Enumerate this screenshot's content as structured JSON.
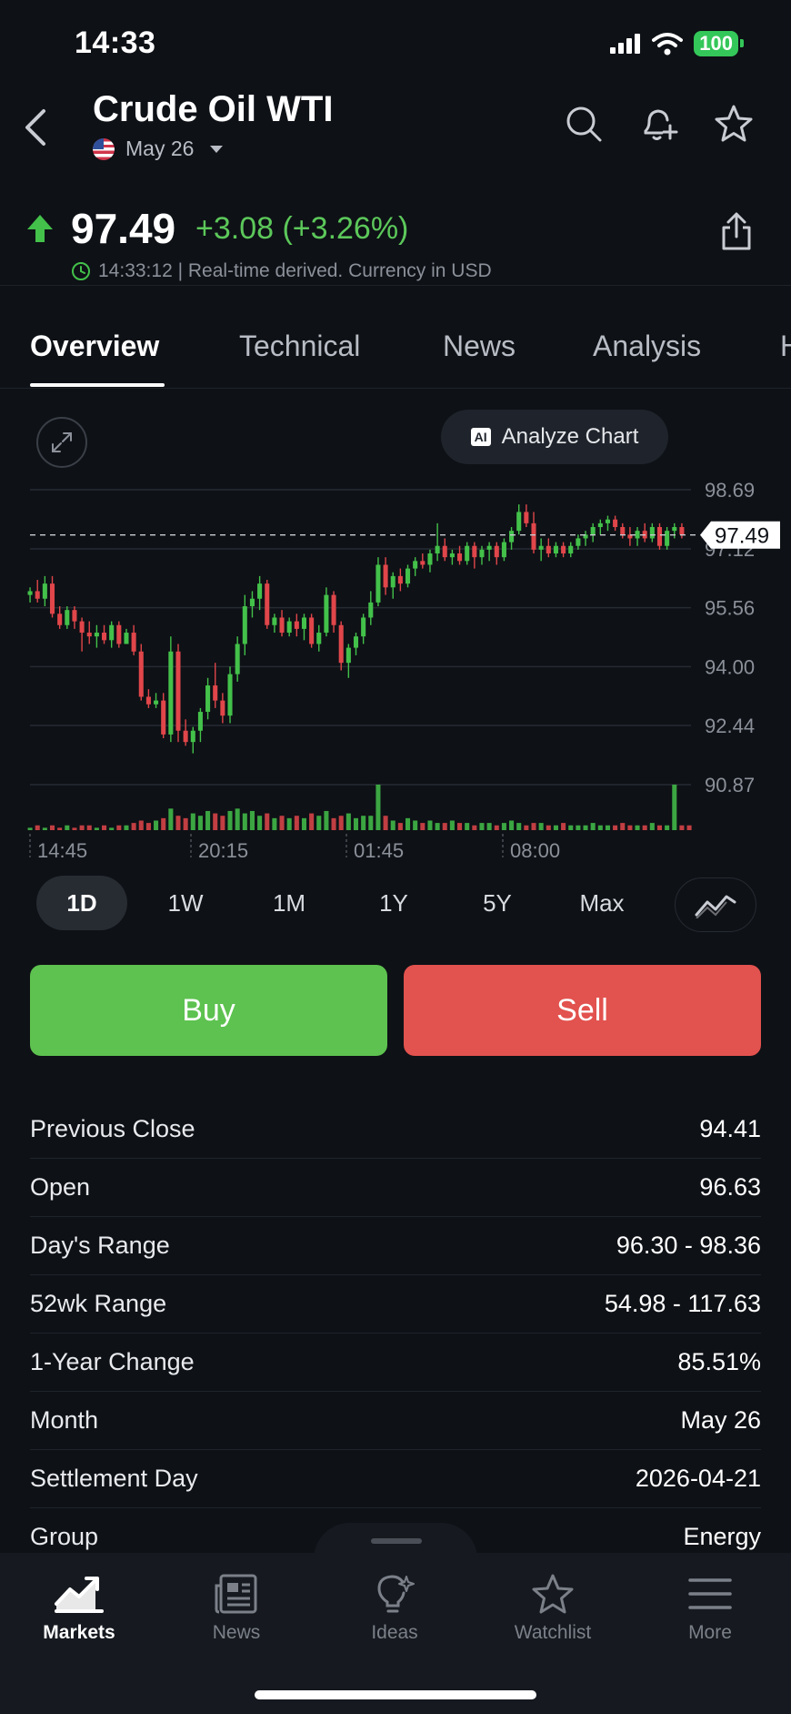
{
  "status_bar": {
    "time": "14:33",
    "battery": "100"
  },
  "header": {
    "title": "Crude Oil WTI",
    "contract": "May 26"
  },
  "quote": {
    "price": "97.49",
    "change": "+3.08 (+3.26%)",
    "timestamp_note": "14:33:12 | Real-time derived. Currency in USD",
    "up_color": "#5cc85a"
  },
  "tabs": [
    "Overview",
    "Technical",
    "News",
    "Analysis",
    "H"
  ],
  "analyze_label": "Analyze Chart",
  "ai_badge": "AI",
  "chart_data": {
    "type": "candlestick",
    "y_ticks": [
      "98.69",
      "97.12",
      "95.56",
      "94.00",
      "92.44",
      "90.87"
    ],
    "ylim": [
      90.87,
      98.69
    ],
    "x_ticks": [
      "14:45",
      "20:15",
      "01:45",
      "08:00"
    ],
    "last_price_label": "97.49",
    "up_color": "#43c14a",
    "down_color": "#e0464a",
    "series": [
      {
        "o": 95.9,
        "h": 96.1,
        "l": 95.7,
        "c": 96.0
      },
      {
        "o": 96.0,
        "h": 96.3,
        "l": 95.7,
        "c": 95.8
      },
      {
        "o": 95.8,
        "h": 96.4,
        "l": 95.6,
        "c": 96.2
      },
      {
        "o": 96.2,
        "h": 96.4,
        "l": 95.3,
        "c": 95.4
      },
      {
        "o": 95.4,
        "h": 95.6,
        "l": 95.0,
        "c": 95.1
      },
      {
        "o": 95.1,
        "h": 95.6,
        "l": 95.0,
        "c": 95.5
      },
      {
        "o": 95.5,
        "h": 95.6,
        "l": 95.0,
        "c": 95.2
      },
      {
        "o": 95.2,
        "h": 95.3,
        "l": 94.4,
        "c": 94.9
      },
      {
        "o": 94.9,
        "h": 95.2,
        "l": 94.6,
        "c": 94.8
      },
      {
        "o": 94.8,
        "h": 95.1,
        "l": 94.5,
        "c": 94.9
      },
      {
        "o": 94.9,
        "h": 95.1,
        "l": 94.6,
        "c": 94.7
      },
      {
        "o": 94.7,
        "h": 95.2,
        "l": 94.5,
        "c": 95.1
      },
      {
        "o": 95.1,
        "h": 95.2,
        "l": 94.5,
        "c": 94.6
      },
      {
        "o": 94.6,
        "h": 95.0,
        "l": 94.6,
        "c": 94.9
      },
      {
        "o": 94.9,
        "h": 95.1,
        "l": 94.3,
        "c": 94.4
      },
      {
        "o": 94.4,
        "h": 94.6,
        "l": 93.1,
        "c": 93.2
      },
      {
        "o": 93.2,
        "h": 93.4,
        "l": 92.9,
        "c": 93.0
      },
      {
        "o": 93.0,
        "h": 93.3,
        "l": 92.9,
        "c": 93.1
      },
      {
        "o": 93.1,
        "h": 93.3,
        "l": 92.1,
        "c": 92.2
      },
      {
        "o": 92.2,
        "h": 94.8,
        "l": 92.0,
        "c": 94.4
      },
      {
        "o": 94.4,
        "h": 94.6,
        "l": 92.0,
        "c": 92.3
      },
      {
        "o": 92.3,
        "h": 92.6,
        "l": 91.9,
        "c": 92.0
      },
      {
        "o": 92.0,
        "h": 92.4,
        "l": 91.7,
        "c": 92.3
      },
      {
        "o": 92.3,
        "h": 92.9,
        "l": 92.0,
        "c": 92.8
      },
      {
        "o": 92.8,
        "h": 93.7,
        "l": 92.6,
        "c": 93.5
      },
      {
        "o": 93.5,
        "h": 94.1,
        "l": 92.9,
        "c": 93.1
      },
      {
        "o": 93.1,
        "h": 93.3,
        "l": 92.5,
        "c": 92.7
      },
      {
        "o": 92.7,
        "h": 94.0,
        "l": 92.5,
        "c": 93.8
      },
      {
        "o": 93.8,
        "h": 94.8,
        "l": 93.6,
        "c": 94.6
      },
      {
        "o": 94.6,
        "h": 95.9,
        "l": 94.3,
        "c": 95.6
      },
      {
        "o": 95.6,
        "h": 96.0,
        "l": 95.3,
        "c": 95.8
      },
      {
        "o": 95.8,
        "h": 96.4,
        "l": 95.5,
        "c": 96.2
      },
      {
        "o": 96.2,
        "h": 96.3,
        "l": 95.0,
        "c": 95.1
      },
      {
        "o": 95.1,
        "h": 95.4,
        "l": 94.9,
        "c": 95.3
      },
      {
        "o": 95.3,
        "h": 95.5,
        "l": 94.8,
        "c": 94.9
      },
      {
        "o": 94.9,
        "h": 95.3,
        "l": 94.8,
        "c": 95.2
      },
      {
        "o": 95.2,
        "h": 95.4,
        "l": 94.8,
        "c": 95.0
      },
      {
        "o": 95.0,
        "h": 95.4,
        "l": 94.7,
        "c": 95.3
      },
      {
        "o": 95.3,
        "h": 95.4,
        "l": 94.5,
        "c": 94.6
      },
      {
        "o": 94.6,
        "h": 95.1,
        "l": 94.4,
        "c": 94.9
      },
      {
        "o": 94.9,
        "h": 96.1,
        "l": 94.8,
        "c": 95.9
      },
      {
        "o": 95.9,
        "h": 96.0,
        "l": 94.9,
        "c": 95.1
      },
      {
        "o": 95.1,
        "h": 95.2,
        "l": 93.9,
        "c": 94.1
      },
      {
        "o": 94.1,
        "h": 94.6,
        "l": 93.7,
        "c": 94.5
      },
      {
        "o": 94.5,
        "h": 94.9,
        "l": 94.3,
        "c": 94.8
      },
      {
        "o": 94.8,
        "h": 95.4,
        "l": 94.6,
        "c": 95.3
      },
      {
        "o": 95.3,
        "h": 96.0,
        "l": 95.1,
        "c": 95.7
      },
      {
        "o": 95.7,
        "h": 96.9,
        "l": 95.6,
        "c": 96.7
      },
      {
        "o": 96.7,
        "h": 96.9,
        "l": 95.9,
        "c": 96.1
      },
      {
        "o": 96.1,
        "h": 96.5,
        "l": 95.8,
        "c": 96.4
      },
      {
        "o": 96.4,
        "h": 96.6,
        "l": 96.0,
        "c": 96.2
      },
      {
        "o": 96.2,
        "h": 96.7,
        "l": 96.1,
        "c": 96.6
      },
      {
        "o": 96.6,
        "h": 96.9,
        "l": 96.4,
        "c": 96.8
      },
      {
        "o": 96.8,
        "h": 97.0,
        "l": 96.6,
        "c": 96.7
      },
      {
        "o": 96.7,
        "h": 97.1,
        "l": 96.5,
        "c": 97.0
      },
      {
        "o": 97.0,
        "h": 97.8,
        "l": 96.8,
        "c": 97.2
      },
      {
        "o": 97.2,
        "h": 97.4,
        "l": 96.8,
        "c": 96.9
      },
      {
        "o": 96.9,
        "h": 97.1,
        "l": 96.7,
        "c": 97.0
      },
      {
        "o": 97.0,
        "h": 97.2,
        "l": 96.7,
        "c": 96.8
      },
      {
        "o": 96.8,
        "h": 97.3,
        "l": 96.7,
        "c": 97.2
      },
      {
        "o": 97.2,
        "h": 97.3,
        "l": 96.6,
        "c": 96.9
      },
      {
        "o": 96.9,
        "h": 97.2,
        "l": 96.7,
        "c": 97.1
      },
      {
        "o": 97.1,
        "h": 97.3,
        "l": 96.8,
        "c": 97.2
      },
      {
        "o": 97.2,
        "h": 97.3,
        "l": 96.7,
        "c": 96.9
      },
      {
        "o": 96.9,
        "h": 97.4,
        "l": 96.8,
        "c": 97.3
      },
      {
        "o": 97.3,
        "h": 97.7,
        "l": 97.1,
        "c": 97.6
      },
      {
        "o": 97.6,
        "h": 98.3,
        "l": 97.5,
        "c": 98.1
      },
      {
        "o": 98.1,
        "h": 98.3,
        "l": 97.7,
        "c": 97.8
      },
      {
        "o": 97.8,
        "h": 98.1,
        "l": 97.0,
        "c": 97.1
      },
      {
        "o": 97.1,
        "h": 97.4,
        "l": 96.8,
        "c": 97.2
      },
      {
        "o": 97.2,
        "h": 97.4,
        "l": 96.9,
        "c": 97.0
      },
      {
        "o": 97.0,
        "h": 97.3,
        "l": 96.9,
        "c": 97.2
      },
      {
        "o": 97.2,
        "h": 97.3,
        "l": 96.9,
        "c": 97.0
      },
      {
        "o": 97.0,
        "h": 97.3,
        "l": 96.9,
        "c": 97.2
      },
      {
        "o": 97.2,
        "h": 97.5,
        "l": 97.1,
        "c": 97.4
      },
      {
        "o": 97.4,
        "h": 97.6,
        "l": 97.2,
        "c": 97.5
      },
      {
        "o": 97.5,
        "h": 97.8,
        "l": 97.3,
        "c": 97.7
      },
      {
        "o": 97.7,
        "h": 97.9,
        "l": 97.5,
        "c": 97.8
      },
      {
        "o": 97.8,
        "h": 98.0,
        "l": 97.6,
        "c": 97.9
      },
      {
        "o": 97.9,
        "h": 98.0,
        "l": 97.6,
        "c": 97.7
      },
      {
        "o": 97.7,
        "h": 97.8,
        "l": 97.4,
        "c": 97.5
      },
      {
        "o": 97.5,
        "h": 97.7,
        "l": 97.2,
        "c": 97.4
      },
      {
        "o": 97.4,
        "h": 97.7,
        "l": 97.2,
        "c": 97.6
      },
      {
        "o": 97.6,
        "h": 97.8,
        "l": 97.3,
        "c": 97.4
      },
      {
        "o": 97.4,
        "h": 97.8,
        "l": 97.3,
        "c": 97.7
      },
      {
        "o": 97.7,
        "h": 97.8,
        "l": 97.1,
        "c": 97.2
      },
      {
        "o": 97.2,
        "h": 97.7,
        "l": 97.1,
        "c": 97.6
      },
      {
        "o": 97.6,
        "h": 97.8,
        "l": 97.4,
        "c": 97.7
      },
      {
        "o": 97.7,
        "h": 97.8,
        "l": 97.4,
        "c": 97.5
      }
    ],
    "volume": [
      1,
      2,
      1,
      2,
      1,
      2,
      1,
      2,
      2,
      1,
      2,
      1,
      2,
      2,
      3,
      4,
      3,
      4,
      5,
      9,
      6,
      5,
      7,
      6,
      8,
      7,
      6,
      8,
      9,
      7,
      8,
      6,
      7,
      5,
      6,
      5,
      6,
      5,
      7,
      6,
      8,
      5,
      6,
      7,
      5,
      6,
      6,
      19,
      6,
      4,
      3,
      5,
      4,
      3,
      4,
      3,
      3,
      4,
      3,
      3,
      2,
      3,
      3,
      2,
      3,
      4,
      3,
      2,
      3,
      3,
      2,
      2,
      3,
      2,
      2,
      2,
      3,
      2,
      2,
      2,
      3,
      2,
      2,
      2,
      3,
      2,
      2,
      19,
      2,
      2
    ]
  },
  "periods": [
    "1D",
    "1W",
    "1M",
    "1Y",
    "5Y",
    "Max"
  ],
  "actions": {
    "buy": "Buy",
    "sell": "Sell"
  },
  "stats": [
    {
      "label": "Previous Close",
      "value": "94.41"
    },
    {
      "label": "Open",
      "value": "96.63"
    },
    {
      "label": "Day's Range",
      "value": "96.30 - 98.36"
    },
    {
      "label": "52wk Range",
      "value": "54.98 - 117.63"
    },
    {
      "label": "1-Year Change",
      "value": "85.51%"
    },
    {
      "label": "Month",
      "value": "May 26"
    },
    {
      "label": "Settlement Day",
      "value": "2026-04-21"
    },
    {
      "label": "Group",
      "value": "Energy"
    }
  ],
  "bottom_nav": [
    {
      "label": "Markets",
      "icon": "markets-chart-icon"
    },
    {
      "label": "News",
      "icon": "newspaper-icon"
    },
    {
      "label": "Ideas",
      "icon": "lightbulb-icon"
    },
    {
      "label": "Watchlist",
      "icon": "star-icon"
    },
    {
      "label": "More",
      "icon": "hamburger-menu-icon"
    }
  ]
}
